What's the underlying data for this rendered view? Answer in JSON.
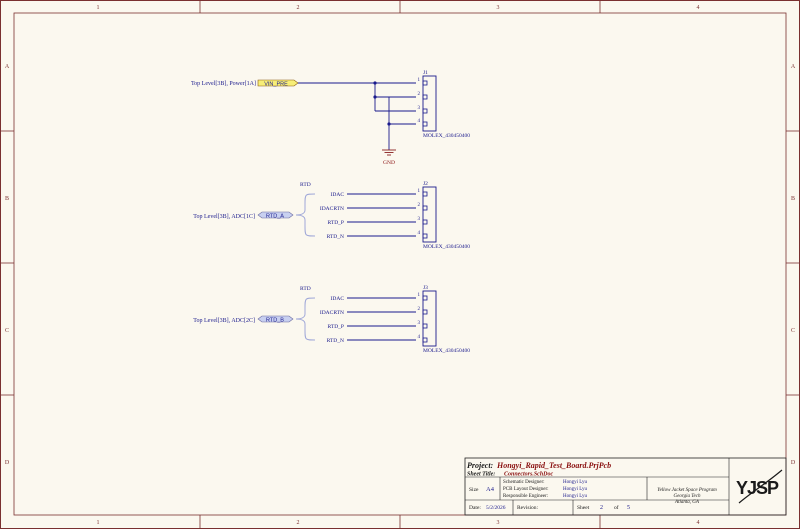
{
  "zones": {
    "cols": [
      "1",
      "2",
      "3",
      "4"
    ],
    "rows": [
      "A",
      "B",
      "C",
      "D"
    ]
  },
  "power": {
    "port_ref": "Top Level[3B], Power[1A]",
    "port_name": "VIN_PRE",
    "gnd_label": "GND"
  },
  "connectors": [
    {
      "ref": "J1",
      "part": "MOLEX_430450400",
      "pins": [
        "1",
        "2",
        "3",
        "4"
      ],
      "nets": [
        "",
        "",
        "",
        ""
      ]
    },
    {
      "ref": "J2",
      "part": "MOLEX_430450400",
      "pins": [
        "1",
        "2",
        "3",
        "4"
      ],
      "nets": [
        "IDAC",
        "IDACRTN",
        "RTD_P",
        "RTD_N"
      ],
      "bus_label": "RTD",
      "port_ref": "Top Level[3B], ADC[1C]",
      "port_name": "RTD_A"
    },
    {
      "ref": "J3",
      "part": "MOLEX_430450400",
      "pins": [
        "1",
        "2",
        "3",
        "4"
      ],
      "nets": [
        "IDAC",
        "IDACRTN",
        "RTD_P",
        "RTD_N"
      ],
      "bus_label": "RTD",
      "port_ref": "Top Level[3B], ADC[2C]",
      "port_name": "RTD_B"
    }
  ],
  "title_block": {
    "project_label": "Project:",
    "project": "Hongyi_Rapid_Test_Board.PrjPcb",
    "sheet_title_label": "Sheet Title:",
    "sheet_title": "Connectors.SchDoc",
    "size_label": "Size",
    "size": "A4",
    "schematic_designer_label": "Schematic Designer:",
    "schematic_designer": "Hongyi Lyu",
    "pcb_designer_label": "PCB Layout Designer:",
    "pcb_designer": "Hongyi Lyu",
    "engineer_label": "Responsible Engineer:",
    "engineer": "Hongyi Lyu",
    "org_line1": "Yellow Jacket Space Program",
    "org_line2": "Georgia Tech",
    "org_line3": "Atlanta, GA",
    "date_label": "Date:",
    "date": "5/2/2026",
    "revision_label": "Revision:",
    "revision": "",
    "sheet_label": "Sheet",
    "sheet_num": "2",
    "of_label": "of",
    "sheet_total": "5",
    "logo_text": "YJSP"
  },
  "colors": {
    "wire": "#1a1a8c",
    "border": "#8a2020",
    "port_fill": "#f7ee77",
    "port_fill_b": "#c8d0f0",
    "text_blue": "#1a1a8c",
    "text_red": "#8a1010",
    "paper": "#fbf8ef"
  }
}
